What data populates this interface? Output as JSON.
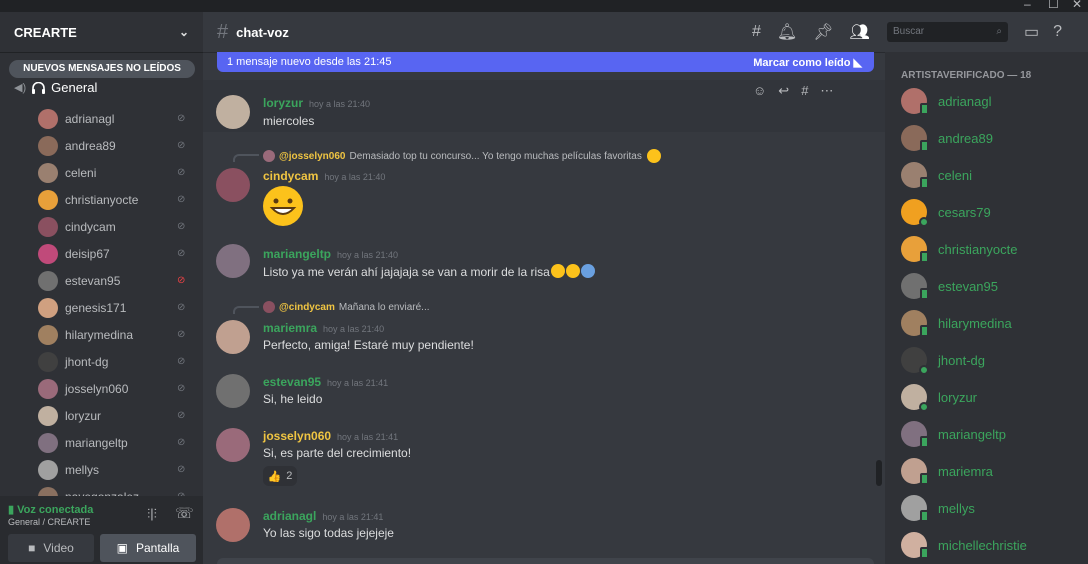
{
  "window": {
    "minimize": "–",
    "maximize": "☐",
    "close": "✕"
  },
  "server": {
    "name": "CREARTE",
    "chevron": "⌄"
  },
  "sidebar": {
    "new_messages_pill": "NUEVOS MENSAJES NO LEÍDOS",
    "voice_channel": "General",
    "voice_users": [
      {
        "name": "adrianagl",
        "color": "#b0706a"
      },
      {
        "name": "andrea89",
        "color": "#8a6a5a"
      },
      {
        "name": "celeni",
        "color": "#9a8070"
      },
      {
        "name": "christianyocte",
        "color": "#e8a03a"
      },
      {
        "name": "cindycam",
        "color": "#8a5060"
      },
      {
        "name": "deisip67",
        "color": "#c04a7a"
      },
      {
        "name": "estevan95",
        "color": "#707070",
        "muted_red": true
      },
      {
        "name": "genesis171",
        "color": "#d0a080"
      },
      {
        "name": "hilarymedina",
        "color": "#a08060"
      },
      {
        "name": "jhont-dg",
        "color": "#404040"
      },
      {
        "name": "josselyn060",
        "color": "#9a6a7a"
      },
      {
        "name": "loryzur",
        "color": "#c0b0a0"
      },
      {
        "name": "mariangeltp",
        "color": "#807080"
      },
      {
        "name": "mellys",
        "color": "#a0a0a0"
      },
      {
        "name": "nayegonzalez",
        "color": "#8a7060"
      }
    ],
    "voice_status": "Voz conectada",
    "voice_sub": "General / CREARTE",
    "video_label": "Video",
    "screen_label": "Pantalla"
  },
  "header": {
    "channel": "chat-voz",
    "search_placeholder": "Buscar"
  },
  "banner": {
    "text": "1 mensaje nuevo desde las 21:45",
    "mark_read": "Marcar como leído"
  },
  "messages": [
    {
      "author": "loryzur",
      "color": "#3ba55d",
      "time": "hoy a las 21:40",
      "text": "miercoles",
      "av": "#c0b0a0"
    },
    {
      "author": "cindycam",
      "color": "#f0c542",
      "time": "hoy a las 21:40",
      "text": "",
      "av": "#8a5060",
      "reply_name": "@josselyn060",
      "reply_text": "Demasiado top tu concurso... Yo tengo muchas películas favoritas"
    },
    {
      "author": "mariangeltp",
      "color": "#3ba55d",
      "time": "hoy a las 21:40",
      "text": "Listo ya me verán ahí jajajaja se van a morir de la risa",
      "av": "#807080"
    },
    {
      "author": "mariemra",
      "color": "#3ba55d",
      "time": "hoy a las 21:40",
      "text": "Perfecto, amiga! Estaré muy pendiente!",
      "av": "#c0a090",
      "reply_name": "@cindycam",
      "reply_text": "Mañana lo enviaré..."
    },
    {
      "author": "estevan95",
      "color": "#3ba55d",
      "time": "hoy a las 21:41",
      "text": "Si, he leido",
      "av": "#707070"
    },
    {
      "author": "josselyn060",
      "color": "#f0c542",
      "time": "hoy a las 21:41",
      "text": "Si, es parte del crecimiento!",
      "av": "#9a6a7a",
      "reaction_count": "2"
    },
    {
      "author": "adrianagl",
      "color": "#3ba55d",
      "time": "hoy a las 21:41",
      "text": "Yo las sigo todas jejejeje",
      "av": "#b0706a"
    }
  ],
  "members": {
    "role": "ARTISTAVERIFICADO — 18",
    "list": [
      {
        "name": "adrianagl",
        "color": "#b0706a",
        "status": "phone"
      },
      {
        "name": "andrea89",
        "color": "#8a6a5a",
        "status": "phone"
      },
      {
        "name": "celeni",
        "color": "#9a8070",
        "status": "phone"
      },
      {
        "name": "cesars79",
        "color": "#f0a020",
        "status": "dot"
      },
      {
        "name": "christianyocte",
        "color": "#e8a03a",
        "status": "phone"
      },
      {
        "name": "estevan95",
        "color": "#707070",
        "status": "phone"
      },
      {
        "name": "hilarymedina",
        "color": "#a08060",
        "status": "phone"
      },
      {
        "name": "jhont-dg",
        "color": "#404040",
        "status": "dot"
      },
      {
        "name": "loryzur",
        "color": "#c0b0a0",
        "status": "dot"
      },
      {
        "name": "mariangeltp",
        "color": "#807080",
        "status": "phone"
      },
      {
        "name": "mariemra",
        "color": "#c0a090",
        "status": "phone"
      },
      {
        "name": "mellys",
        "color": "#a0a0a0",
        "status": "phone"
      },
      {
        "name": "michellechristie",
        "color": "#d0b0a0",
        "status": "phone"
      }
    ]
  }
}
